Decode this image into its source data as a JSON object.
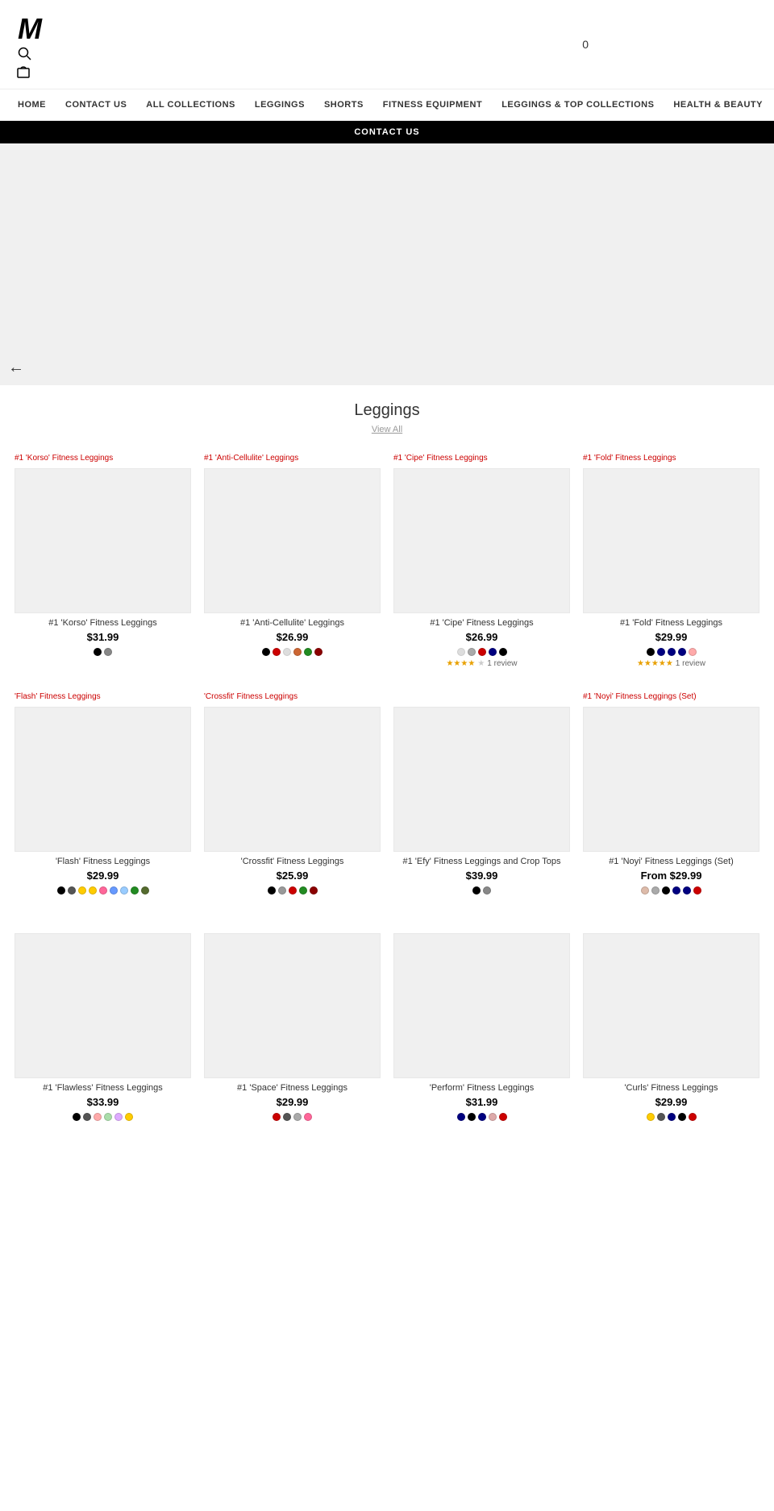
{
  "header": {
    "logo": "M",
    "cart_count": "0",
    "search_icon": "🔍",
    "cart_icon": "🛍"
  },
  "nav": {
    "items": [
      {
        "label": "HOME",
        "id": "home"
      },
      {
        "label": "CONTACT US",
        "id": "contact"
      },
      {
        "label": "ALL COLLECTIONS",
        "id": "all-collections"
      },
      {
        "label": "LEGGINGS",
        "id": "leggings"
      },
      {
        "label": "SHORTS",
        "id": "shorts"
      },
      {
        "label": "FITNESS EQUIPMENT",
        "id": "fitness-equipment"
      },
      {
        "label": "LEGGINGS & TOP COLLECTIONS",
        "id": "leggings-top"
      },
      {
        "label": "HEALTH & BEAUTY",
        "id": "health-beauty"
      }
    ]
  },
  "dropdown_label": "CONTACT US",
  "section": {
    "title": "Leggings",
    "view_all": "View All"
  },
  "products_row1": [
    {
      "label": "#1 'Korso' Fitness Leggings",
      "name": "#1 'Korso' Fitness Leggings",
      "price": "$31.99",
      "colors": [
        "#000000",
        "#888888"
      ],
      "rating": null,
      "review_count": null
    },
    {
      "label": "#1 'Anti-Cellulite' Leggings",
      "name": "#1 'Anti-Cellulite' Leggings",
      "price": "$26.99",
      "colors": [
        "#000000",
        "#cc0000",
        "#ffffff",
        "#cc6633",
        "#228B22",
        "#8B0000"
      ],
      "rating": null,
      "review_count": null
    },
    {
      "label": "#1 'Cipe' Fitness Leggings",
      "name": "#1 'Cipe' Fitness Leggings",
      "price": "$26.99",
      "colors": [
        "#ffffff",
        "#aaaaaa",
        "#cc0000",
        "#000080",
        "#000000"
      ],
      "rating": 4.5,
      "review_count": "1 review"
    },
    {
      "label": "#1 'Fold' Fitness Leggings",
      "name": "#1 'Fold' Fitness Leggings",
      "price": "$29.99",
      "colors": [
        "#000000",
        "#000080",
        "#000080",
        "#000080",
        "#ffaaaa"
      ],
      "rating": 5,
      "review_count": "1 review"
    }
  ],
  "products_row2": [
    {
      "label": "'Flash' Fitness Leggings",
      "name": "'Flash' Fitness Leggings",
      "price": "$29.99",
      "colors": [
        "#000000",
        "#555555",
        "#ffcc00",
        "#ffcc00",
        "#ff6699",
        "#6699ff",
        "#99ccff",
        "#228B22",
        "#556B2F"
      ],
      "rating": null,
      "review_count": null
    },
    {
      "label": "'Crossfit' Fitness Leggings",
      "name": "'Crossfit' Fitness Leggings",
      "price": "$25.99",
      "colors": [
        "#000000",
        "#999999",
        "#cc0000",
        "#228B22",
        "#8B0000"
      ],
      "rating": null,
      "review_count": null
    },
    {
      "label": null,
      "name": "#1 'Efy' Fitness Leggings and Crop Tops",
      "price": "$39.99",
      "colors": [
        "#000000",
        "#888888"
      ],
      "rating": null,
      "review_count": null
    },
    {
      "label": "#1 'Noyi' Fitness Leggings (Set)",
      "name": "#1 'Noyi' Fitness Leggings (Set)",
      "price": "From $29.99",
      "colors": [
        "#ddbbaa",
        "#aaaaaa",
        "#000000",
        "#000080",
        "#000080",
        "#cc0000"
      ],
      "rating": null,
      "review_count": null
    }
  ],
  "products_row3": [
    {
      "label": null,
      "name": "#1 'Flawless' Fitness Leggings",
      "price": "$33.99",
      "colors": [
        "#000000",
        "#555555",
        "#ffaaaa",
        "#aaddaa",
        "#ddaaff",
        "#ffcc00"
      ],
      "rating": null,
      "review_count": null
    },
    {
      "label": null,
      "name": "#1 'Space' Fitness Leggings",
      "price": "$29.99",
      "colors": [
        "#cc0000",
        "#555555",
        "#aaaaaa",
        "#ff6699"
      ],
      "rating": null,
      "review_count": null
    },
    {
      "label": null,
      "name": "'Perform' Fitness Leggings",
      "price": "$31.99",
      "colors": [
        "#000080",
        "#000000",
        "#000080",
        "#ddaaaa",
        "#cc0000"
      ],
      "rating": null,
      "review_count": null
    },
    {
      "label": null,
      "name": "'Curls' Fitness Leggings",
      "price": "$29.99",
      "colors": [
        "#ffcc00",
        "#555555",
        "#000080",
        "#000000",
        "#cc0000"
      ],
      "rating": null,
      "review_count": null
    }
  ]
}
